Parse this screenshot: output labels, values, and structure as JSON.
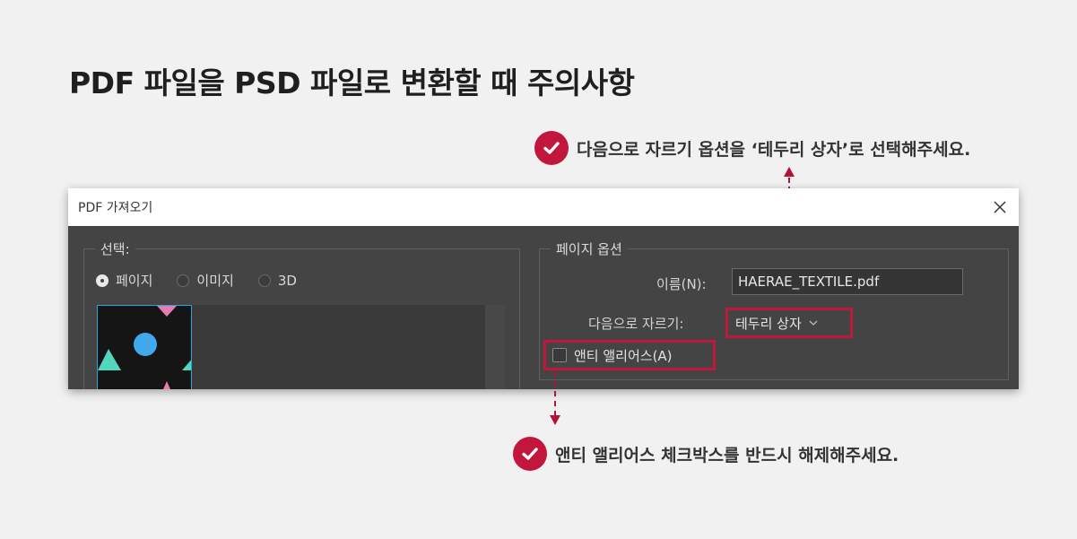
{
  "headline": "PDF 파일을 PSD 파일로 변환할 때 주의사항",
  "callouts": {
    "top": "다음으로 자르기 옵션을 ‘테두리 상자’로 선택해주세요.",
    "bottom": "앤티 앨리어스 체크박스를 반드시 해제해주세요."
  },
  "dialog": {
    "title": "PDF 가져오기",
    "select_group": {
      "legend": "선택:",
      "radios": [
        {
          "label": "페이지",
          "selected": true
        },
        {
          "label": "이미지",
          "selected": false
        },
        {
          "label": "3D",
          "selected": false
        }
      ]
    },
    "page_options": {
      "legend": "페이지 옵션",
      "name_label": "이름(N):",
      "name_value": "HAERAE_TEXTILE.pdf",
      "crop_label": "다음으로 자르기:",
      "crop_value": "테두리 상자",
      "antialias_label": "앤티 앨리어스(A)",
      "antialias_checked": false
    }
  },
  "colors": {
    "accent": "#c3163d",
    "dialog_bg": "#444444",
    "page_bg": "#f1f1f1",
    "thumb_selection": "#1fa6e6"
  },
  "icons": {
    "check": "check-icon",
    "close": "close-icon",
    "dropdown": "chevron-down-icon"
  }
}
